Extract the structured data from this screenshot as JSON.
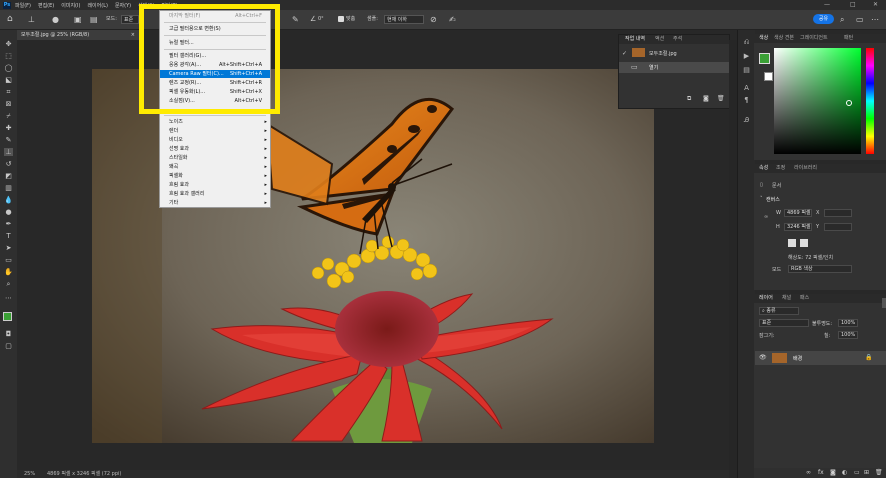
{
  "app": {
    "logo": "Ps"
  },
  "menubar": {
    "items": [
      "파일(F)",
      "편집(E)",
      "이미지(I)",
      "레이어(L)",
      "문자(Y)",
      "선택(S)",
      "필터(T)"
    ]
  },
  "window_controls": {
    "minimize": "—",
    "maximize": "□",
    "close": "✕"
  },
  "options": {
    "mode_label": "모드:",
    "mode_value": "표준",
    "angle_value": "0°",
    "align_label": "맞춤",
    "sample_label": "샘플:",
    "sample_value": "현재 이하",
    "share_label": "공유"
  },
  "document": {
    "tab_title": "모두조절.jpg @ 25% (RGB/8)",
    "close": "×"
  },
  "filter_menu": {
    "items": [
      {
        "label": "마지막 필터(F)",
        "shortcut": "Alt+Ctrl+F",
        "disabled": true
      },
      {
        "label": "고급 필터용으로 변환(S)"
      },
      {
        "label": "뉴럴 필터..."
      },
      {
        "label": "필터 갤러리(G)..."
      },
      {
        "label": "응용 광각(A)...",
        "shortcut": "Alt+Shift+Ctrl+A"
      },
      {
        "label": "Camera Raw 필터(C)...",
        "shortcut": "Shift+Ctrl+A",
        "highlighted": true
      },
      {
        "label": "렌즈 교정(R)...",
        "shortcut": "Shift+Ctrl+R"
      },
      {
        "label": "픽셀 유동화(L)...",
        "shortcut": "Shift+Ctrl+X"
      },
      {
        "label": "소실점(V)...",
        "shortcut": "Alt+Ctrl+V"
      },
      {
        "label": "노이즈",
        "submenu": true
      },
      {
        "label": "렌더",
        "submenu": true
      },
      {
        "label": "비디오",
        "submenu": true
      },
      {
        "label": "선명 효과",
        "submenu": true
      },
      {
        "label": "스타일화",
        "submenu": true
      },
      {
        "label": "왜곡",
        "submenu": true
      },
      {
        "label": "픽셀화",
        "submenu": true
      },
      {
        "label": "흐림 효과",
        "submenu": true
      },
      {
        "label": "흐림 효과 갤러리",
        "submenu": true
      },
      {
        "label": "기타",
        "submenu": true
      }
    ]
  },
  "history_panel": {
    "tabs": [
      "작업 내역",
      "액션",
      "주석"
    ],
    "snapshot": "모두조절.jpg",
    "step": "열기"
  },
  "color_panel": {
    "tabs": [
      "색상",
      "색상 견본",
      "그레이디언트",
      "패턴"
    ],
    "foreground": "#3aa035",
    "background": "#ffffff",
    "hue": "#00ff30"
  },
  "properties_panel": {
    "tabs": [
      "속성",
      "조정",
      "라이브러리"
    ],
    "doc_label": "문서",
    "section": "캔버스",
    "w_label": "W",
    "w_value": "4869 픽셀",
    "h_label": "H",
    "h_value": "3246 픽셀",
    "x_label": "X",
    "y_label": "Y",
    "resolution": "해상도: 72 픽셀/인치",
    "mode_label": "모드",
    "mode_value": "RGB 색상"
  },
  "layers_panel": {
    "tabs": [
      "레이어",
      "채널",
      "패스"
    ],
    "filter_placeholder": "종류",
    "blend": "표준",
    "opacity_label": "불투명도:",
    "opacity_value": "100%",
    "lock_label": "잠그기:",
    "fill_label": "칠:",
    "fill_value": "100%",
    "layer_name": "배경"
  },
  "statusbar": {
    "zoom": "25%",
    "info": "4869 픽셀 x 3246 픽셀 (72 ppi)"
  }
}
